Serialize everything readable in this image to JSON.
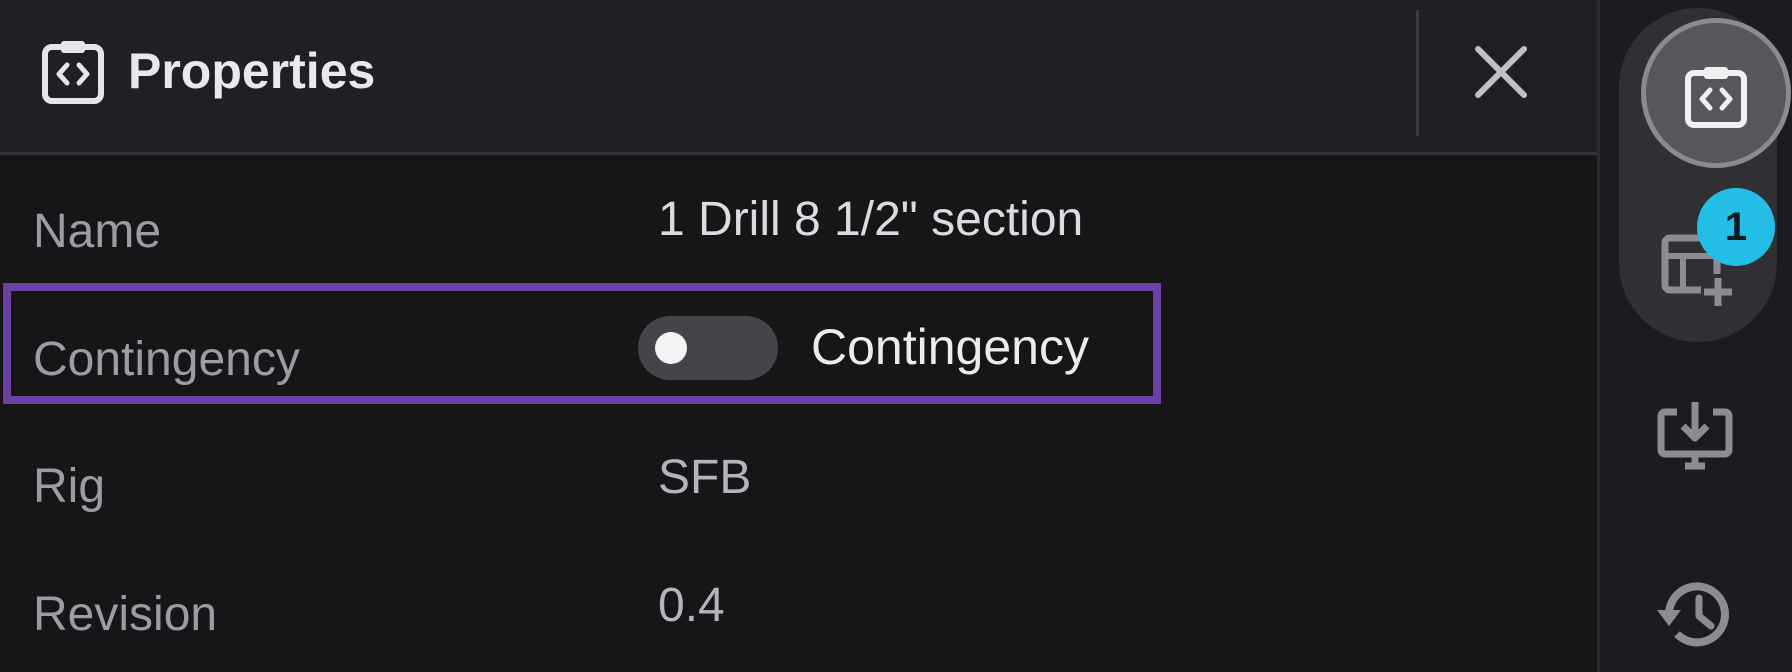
{
  "panel": {
    "title": "Properties",
    "header_icon": "clipboard-code-icon",
    "close_icon": "close-icon"
  },
  "properties": {
    "name": {
      "label": "Name",
      "value": "1 Drill 8 1/2\" section"
    },
    "contingency": {
      "label": "Contingency",
      "toggle_label": "Contingency",
      "toggle_on": false
    },
    "rig": {
      "label": "Rig",
      "value": "SFB"
    },
    "revision": {
      "label": "Revision",
      "value": "0.4"
    }
  },
  "rail": {
    "items": [
      {
        "icon": "clipboard-code-icon",
        "active": true
      },
      {
        "icon": "table-add-icon",
        "badge": "1"
      },
      {
        "icon": "monitor-download-icon"
      },
      {
        "icon": "history-icon"
      }
    ]
  },
  "colors": {
    "highlight": "#6a40a2",
    "badge": "#24bde6",
    "background": "#161619"
  }
}
